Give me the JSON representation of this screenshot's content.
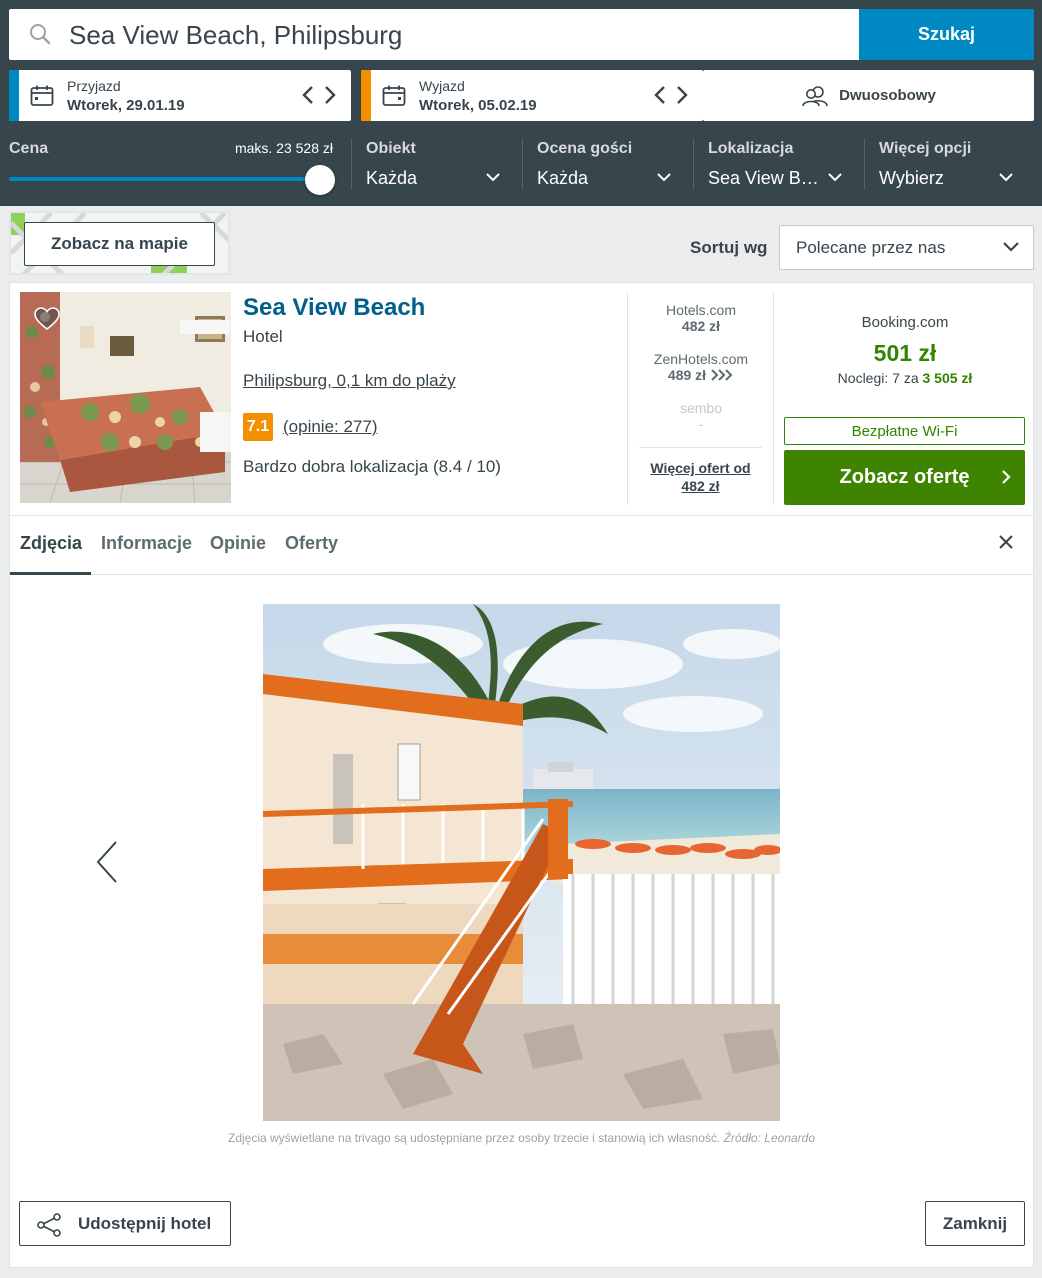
{
  "search": {
    "query": "Sea View Beach, Philipsburg",
    "button_label": "Szukaj"
  },
  "checkin": {
    "label": "Przyjazd",
    "value": "Wtorek, 29.01.19",
    "accent": "#0088c3"
  },
  "checkout": {
    "label": "Wyjazd",
    "value": "Wtorek, 05.02.19",
    "accent": "#f48f00"
  },
  "room": {
    "label": "Dwuosobowy"
  },
  "filters": {
    "price": {
      "label": "Cena",
      "max_label": "maks. 23 528 zł",
      "level": 1.0
    },
    "property": {
      "label": "Obiekt",
      "value": "Każda"
    },
    "guest_rating": {
      "label": "Ocena gości",
      "value": "Każda"
    },
    "location": {
      "label": "Lokalizacja",
      "value": "Sea View Be…"
    },
    "more": {
      "label": "Więcej opcji",
      "value": "Wybierz"
    }
  },
  "map_button": "Zobacz na mapie",
  "sort": {
    "label": "Sortuj wg",
    "value": "Polecane przez nas"
  },
  "hotel": {
    "name": "Sea View Beach",
    "type": "Hotel",
    "location": "Philipsburg, 0,1 km do plaży",
    "rating": "7.1",
    "reviews": "(opinie: 277)",
    "location_score": "Bardzo dobra lokalizacja (8.4 / 10)"
  },
  "deals": [
    {
      "site": "Hotels.com",
      "price": "482 zł"
    },
    {
      "site": "ZenHotels.com",
      "price": "489 zł"
    },
    {
      "site": "sembo",
      "price": "-"
    }
  ],
  "more_offers": "Więcej ofert od 482 zł",
  "best_deal": {
    "site": "Booking.com",
    "price": "501 zł",
    "nights_prefix": "Noclegi: 7 za",
    "nights_total": "3 505 zł",
    "badge": "Bezpłatne Wi-Fi",
    "cta": "Zobacz ofertę"
  },
  "tabs": [
    "Zdjęcia",
    "Informacje",
    "Opinie",
    "Oferty"
  ],
  "photo_credit": "Zdjęcia wyświetlane na trivago są udostępniane przez osoby trzecie i stanowią ich własność.",
  "photo_source": "Źródło: Leonardo",
  "share_button": "Udostępnij hotel",
  "close_button": "Zamknij"
}
